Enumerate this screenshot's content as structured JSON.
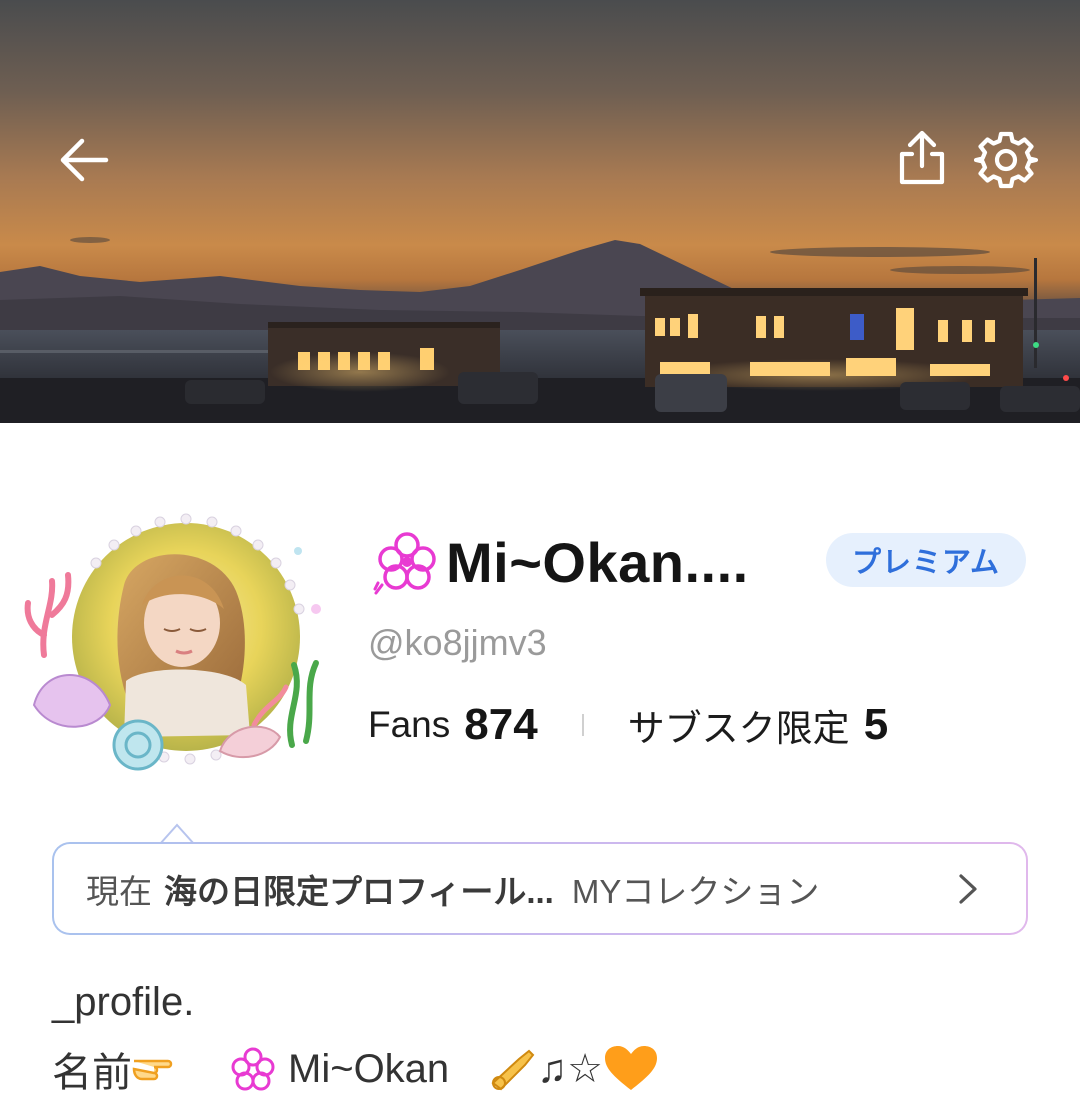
{
  "header": {
    "back_icon": "arrow-left-icon",
    "share_icon": "share-upload-icon",
    "settings_icon": "gear-icon"
  },
  "profile": {
    "name": "Mi~Okan....",
    "name_icon": "pink-flower-icon",
    "badge": "プレミアム",
    "handle": "@ko8jjmv3",
    "stats": [
      {
        "label": "Fans",
        "value": "874"
      },
      {
        "label": "サブスク限定",
        "value": "5"
      }
    ]
  },
  "collection": {
    "prefix": "現在",
    "title": "海の日限定プロフィール...",
    "link": "MYコレクション"
  },
  "bio": {
    "line1": "_profile.",
    "line2_prefix": "名前",
    "line2_name": "Mi~Okan",
    "line2_suffix": "♫☆"
  },
  "colors": {
    "badge_bg": "#e6f0fd",
    "badge_text": "#2f6fdb",
    "accent_pink": "#e83ad2"
  }
}
